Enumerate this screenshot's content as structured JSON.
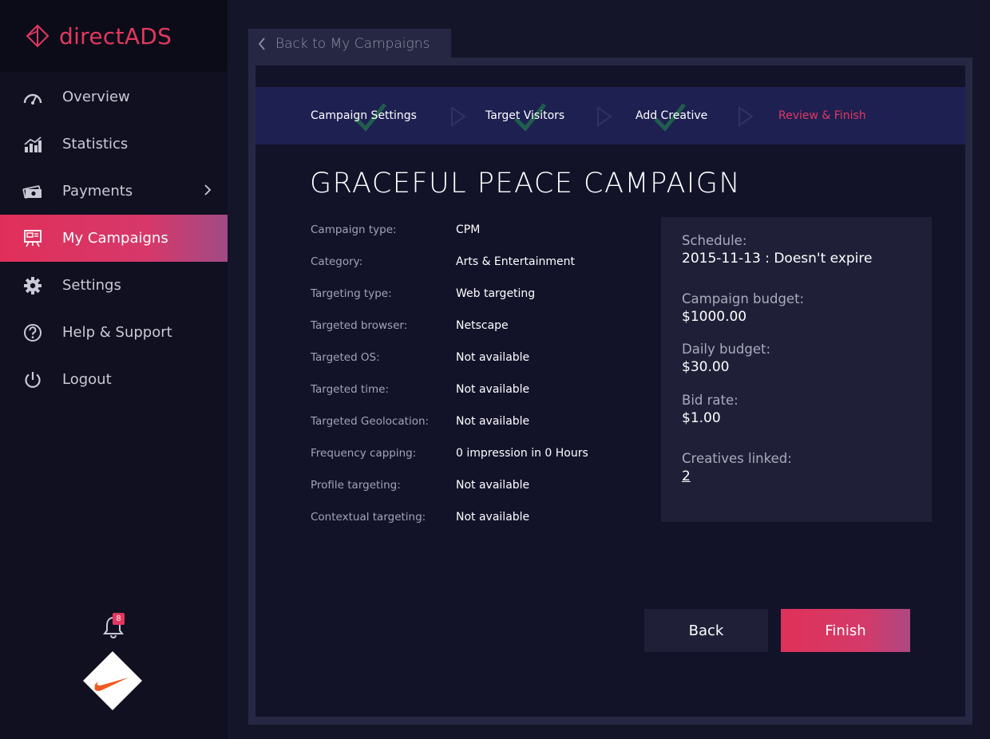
{
  "brand": {
    "name": "directADS",
    "accent": "#e2385f"
  },
  "sidebar": {
    "items": [
      {
        "label": "Overview",
        "icon": "speedometer-icon"
      },
      {
        "label": "Statistics",
        "icon": "chart-icon"
      },
      {
        "label": "Payments",
        "icon": "money-icon"
      },
      {
        "label": "My Campaigns",
        "icon": "presentation-icon",
        "active": true
      },
      {
        "label": "Settings",
        "icon": "gear-icon"
      },
      {
        "label": "Help & Support",
        "icon": "help-icon"
      },
      {
        "label": "Logout",
        "icon": "power-icon"
      }
    ],
    "notifications": {
      "count": "8",
      "icon": "bell-icon"
    },
    "avatar": {
      "icon": "nike-swoosh-icon"
    }
  },
  "main": {
    "back_link": "Back to My Campaigns",
    "steps": [
      {
        "label": "Campaign Settings",
        "done": true
      },
      {
        "label": "Target Visitors",
        "done": true
      },
      {
        "label": "Add Creative",
        "done": true
      },
      {
        "label": "Review & Finish",
        "active": true
      }
    ],
    "title": "GRACEFUL PEACE CAMPAIGN",
    "details": [
      {
        "label": "Campaign type:",
        "value": "CPM"
      },
      {
        "label": "Category:",
        "value": "Arts & Entertainment"
      },
      {
        "label": "Targeting type:",
        "value": "Web targeting"
      },
      {
        "label": "Targeted browser:",
        "value": "Netscape"
      },
      {
        "label": "Targeted OS:",
        "value": "Not available"
      },
      {
        "label": "Targeted time:",
        "value": "Not available"
      },
      {
        "label": "Targeted Geolocation:",
        "value": "Not available"
      },
      {
        "label": "Frequency capping:",
        "value": "0 impression in 0 Hours"
      },
      {
        "label": "Profile targeting:",
        "value": "Not available"
      },
      {
        "label": "Contextual targeting:",
        "value": "Not available"
      }
    ],
    "summary": {
      "schedule_label": "Schedule:",
      "schedule_value": "2015-11-13 : Doesn't expire",
      "budget_label": "Campaign budget:",
      "budget_value": "$1000.00",
      "daily_label": "Daily budget:",
      "daily_value": "$30.00",
      "bid_label": "Bid rate:",
      "bid_value": "$1.00",
      "creatives_label": "Creatives linked:",
      "creatives_value": "2"
    },
    "buttons": {
      "back": "Back",
      "finish": "Finish"
    }
  }
}
